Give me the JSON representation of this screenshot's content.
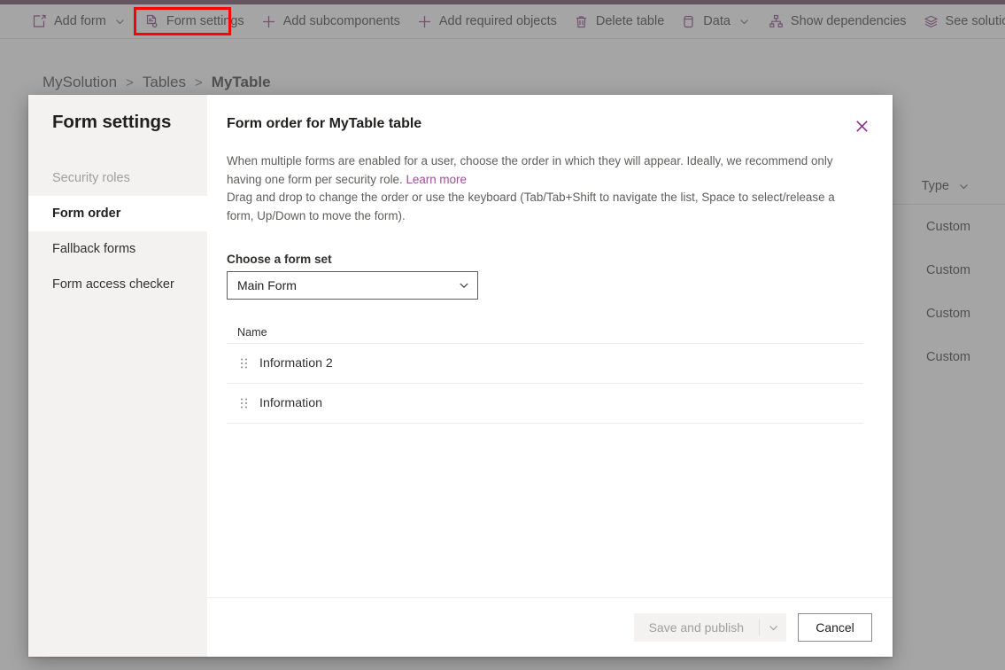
{
  "theme": {
    "accent_purple": "#742774",
    "top_bar": "#522b4b",
    "highlight_red": "#ff0000",
    "link_purple": "#9b4f96",
    "sidebar_bg": "#f3f2f1",
    "scrim": "#6e6e6e"
  },
  "command_bar": {
    "items": [
      {
        "label": "Add form",
        "icon": "add-form-icon",
        "has_caret": true
      },
      {
        "label": "Form settings",
        "icon": "form-settings-icon",
        "has_caret": false,
        "highlighted": true
      },
      {
        "label": "Add subcomponents",
        "icon": "plus-icon",
        "has_caret": false
      },
      {
        "label": "Add required objects",
        "icon": "plus-icon",
        "has_caret": false
      },
      {
        "label": "Delete table",
        "icon": "trash-icon",
        "has_caret": false
      },
      {
        "label": "Data",
        "icon": "database-icon",
        "has_caret": true
      },
      {
        "label": "Show dependencies",
        "icon": "dependencies-icon",
        "has_caret": false
      },
      {
        "label": "See solution layers",
        "icon": "layers-icon",
        "has_caret": false
      }
    ]
  },
  "breadcrumb": {
    "items": [
      {
        "label": "MySolution",
        "current": false
      },
      {
        "label": "Tables",
        "current": false
      },
      {
        "label": "MyTable",
        "current": true
      }
    ],
    "separator": ">"
  },
  "background_table": {
    "column_header": "Type",
    "rows": [
      {
        "type": "Custom"
      },
      {
        "type": "Custom"
      },
      {
        "type": "Custom"
      },
      {
        "type": "Custom"
      }
    ]
  },
  "dialog": {
    "sidebar": {
      "title": "Form settings",
      "items": [
        {
          "label": "Security roles",
          "state": "disabled"
        },
        {
          "label": "Form order",
          "state": "selected"
        },
        {
          "label": "Fallback forms",
          "state": "default"
        },
        {
          "label": "Form access checker",
          "state": "default"
        }
      ]
    },
    "close_icon": "close-icon",
    "title": "Form order for MyTable table",
    "description_part1": "When multiple forms are enabled for a user, choose the order in which they will appear. Ideally, we recommend only having one form per security role. ",
    "learn_more_label": "Learn more",
    "description_part2": "Drag and drop to change the order or use the keyboard (Tab/Tab+Shift to navigate the list, Space to select/release a form, Up/Down to move the form).",
    "form_set": {
      "label": "Choose a form set",
      "selected_value": "Main Form",
      "options": [
        "Main Form"
      ]
    },
    "form_list": {
      "column_header": "Name",
      "rows": [
        {
          "name": "Information 2",
          "handle_icon": "drag-handle-icon"
        },
        {
          "name": "Information",
          "handle_icon": "drag-handle-icon"
        }
      ]
    },
    "footer": {
      "save_label": "Save and publish",
      "save_enabled": false,
      "save_menu_icon": "chevron-down-icon",
      "cancel_label": "Cancel"
    }
  }
}
